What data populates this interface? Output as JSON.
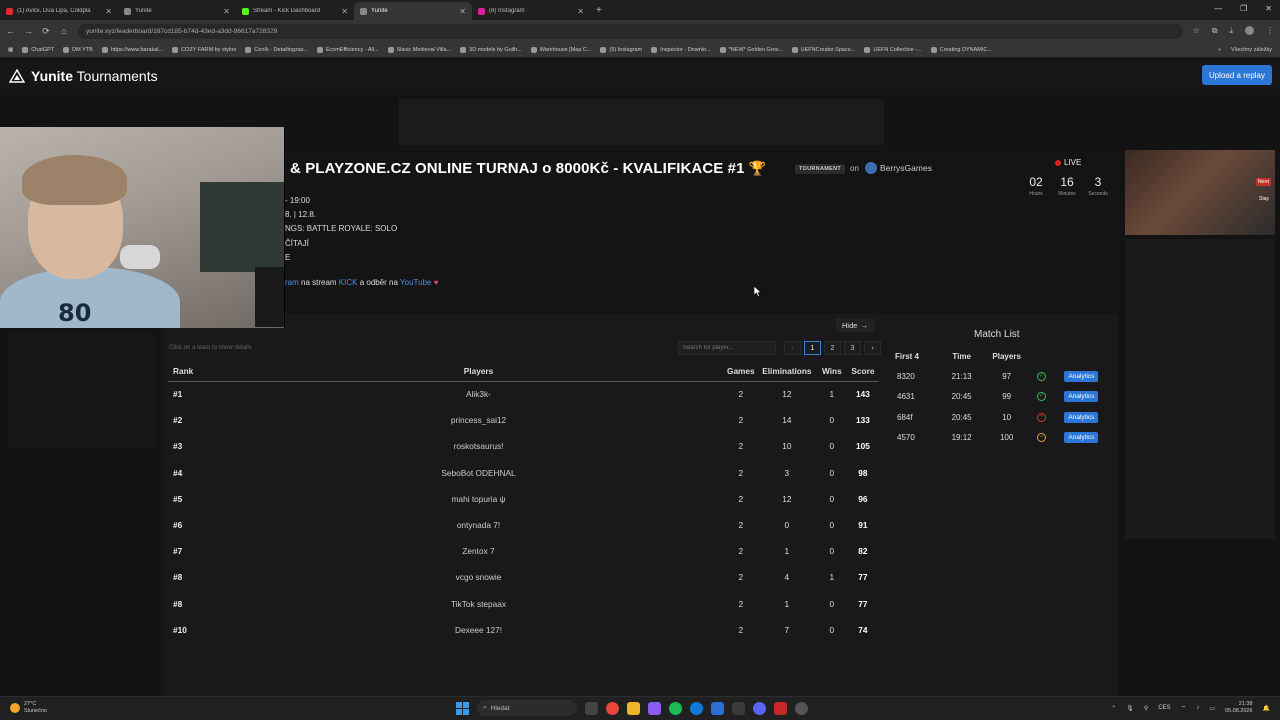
{
  "browser": {
    "tabs": [
      {
        "label": "(1) Avicii, Dua Lipa, Coldpla",
        "color": "#e02b2b",
        "active": false
      },
      {
        "label": "Yunite",
        "color": "#888888",
        "active": false
      },
      {
        "label": "Stream - Kick Dashboard",
        "color": "#53fc18",
        "active": false
      },
      {
        "label": "Yunite",
        "color": "#888888",
        "active": true
      },
      {
        "label": "(8) Instagram",
        "color": "#d6249f",
        "active": false
      }
    ],
    "url": "yunite.xyz/leaderboard/287cd185-b74d-43ed-a3dd-96617a728329",
    "bookmarks": [
      "ChatGPT",
      "DM YTB",
      "https://www.barakal...",
      "COZY FARM by styloo",
      "Ceník - Detailingzav...",
      "EcomEfficiency - All...",
      "Slavic Medieval Villa...",
      "3D models by Guilh...",
      "Warehouse [Map C...",
      "(5) Instagram",
      "Inspector - Downlo...",
      "*NEW* Golden Grov...",
      "UEFNCreator.Space...",
      "UEFN Collective -...",
      "Creating DYNAMIC..."
    ],
    "bookmarks_right": "Všechny záložky"
  },
  "site": {
    "logo_bold": "Yunite",
    "logo_rest": " Tournaments",
    "upload_label": "Upload a replay"
  },
  "tournament": {
    "title": "& PLAYZONE.CZ ONLINE TURNAJ o 8000Kč - KVALIFIKACE #1",
    "trophy": "🏆",
    "badge": "TOURNAMENT",
    "on": "on",
    "organizer": "BerrysGames",
    "info": {
      "line1": "- 19:00",
      "line2": "8. | 12.8.",
      "line3": "NGS: BATTLE ROYALE: SOLO",
      "line4": "ČÍTAJÍ",
      "line5": "E",
      "promo_a": "ram",
      "promo_b": " na stream ",
      "promo_kick": "KICK",
      "promo_c": " a odběr na ",
      "promo_yt": "YouTube",
      "promo_heart": "♥"
    },
    "live_label": "LIVE",
    "countdown": {
      "hours": "02",
      "hours_lbl": "Hours",
      "minutes": "16",
      "minutes_lbl": "Minutes",
      "seconds": "3",
      "seconds_lbl": "Seconds"
    }
  },
  "sidebar_stream": {
    "next": "Next",
    "stay": "Stay"
  },
  "webcam": {
    "jersey": "80"
  },
  "leaderboard": {
    "hide_label": "Hide",
    "hint": "Click on a team to show details",
    "search_placeholder": "Search for player...",
    "pages": [
      "1",
      "2",
      "3"
    ],
    "headers": {
      "rank": "Rank",
      "players": "Players",
      "games": "Games",
      "elims": "Eliminations",
      "wins": "Wins",
      "score": "Score"
    },
    "rows": [
      {
        "rank": "#1",
        "player": "Alik3k-",
        "games": "2",
        "elims": "12",
        "wins": "1",
        "score": "143"
      },
      {
        "rank": "#2",
        "player": "princess_sai12",
        "games": "2",
        "elims": "14",
        "wins": "0",
        "score": "133"
      },
      {
        "rank": "#3",
        "player": "roskotsaurus!",
        "games": "2",
        "elims": "10",
        "wins": "0",
        "score": "105"
      },
      {
        "rank": "#4",
        "player": "SeboBot ODEHNAL",
        "games": "2",
        "elims": "3",
        "wins": "0",
        "score": "98"
      },
      {
        "rank": "#5",
        "player": "mahi topuria ψ",
        "games": "2",
        "elims": "12",
        "wins": "0",
        "score": "96"
      },
      {
        "rank": "#6",
        "player": "ontynada 7!",
        "games": "2",
        "elims": "0",
        "wins": "0",
        "score": "91"
      },
      {
        "rank": "#7",
        "player": "Zentox 7",
        "games": "2",
        "elims": "1",
        "wins": "0",
        "score": "82"
      },
      {
        "rank": "#8",
        "player": "vcgo snowie",
        "games": "2",
        "elims": "4",
        "wins": "1",
        "score": "77"
      },
      {
        "rank": "#8",
        "player": "TikTok stepaax",
        "games": "2",
        "elims": "1",
        "wins": "0",
        "score": "77"
      },
      {
        "rank": "#10",
        "player": "Dexeee 127!",
        "games": "2",
        "elims": "7",
        "wins": "0",
        "score": "74"
      }
    ]
  },
  "match_list": {
    "title": "Match List",
    "headers": {
      "first": "First 4",
      "time": "Time",
      "players": "Players"
    },
    "analytics_label": "Analytics",
    "rows": [
      {
        "first": "8320",
        "time": "21:13",
        "players": "97",
        "status_color": "#3fb950",
        "status_glyph": "✓"
      },
      {
        "first": "4631",
        "time": "20:45",
        "players": "99",
        "status_color": "#3fb950",
        "status_glyph": "✓"
      },
      {
        "first": "684f",
        "time": "20:45",
        "players": "10",
        "status_color": "#d9342b",
        "status_glyph": "•"
      },
      {
        "first": "4570",
        "time": "19:12",
        "players": "100",
        "status_color": "#e0a526",
        "status_glyph": "−"
      }
    ]
  },
  "taskbar": {
    "temp": "27°C",
    "weather": "Slunečno",
    "search": "Hledat",
    "lang": "CES",
    "time": "21:38",
    "date": "05.08.2026"
  }
}
